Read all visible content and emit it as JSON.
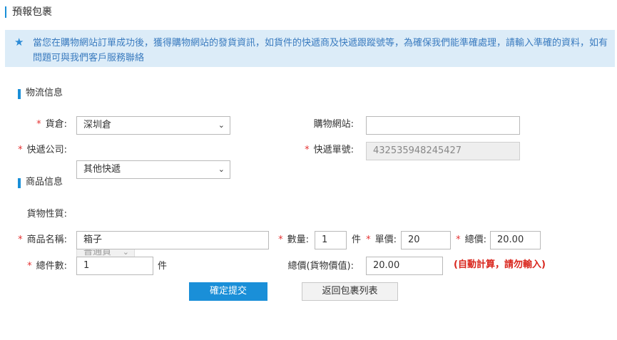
{
  "page": {
    "title": "預報包裹"
  },
  "notice": {
    "icon": "star-icon",
    "text": "當您在購物網站訂單成功後，獲得購物網站的發貨資訊，如貨件的快遞商及快遞跟蹤號等，為確保我們能準確處理，請輸入準確的資料，如有問題可與我們客戶服務聯絡"
  },
  "logistics": {
    "section_title": "物流信息",
    "warehouse": {
      "label": "貨倉:",
      "value": "深圳倉"
    },
    "shop_site": {
      "label": "購物網站:",
      "value": ""
    },
    "courier": {
      "label": "快遞公司:",
      "value": "其他快遞"
    },
    "tracking_no": {
      "label": "快遞單號:",
      "value": "432535948245427"
    }
  },
  "goods": {
    "section_title": "商品信息",
    "nature": {
      "label": "貨物性質:",
      "value": "普通貨"
    },
    "name": {
      "label": "商品名稱:",
      "value": "箱子"
    },
    "quantity": {
      "label": "數量:",
      "value": "1",
      "unit": "件"
    },
    "unit_price": {
      "label": "單價:",
      "value": "20"
    },
    "total_price": {
      "label": "總價:",
      "value": "20.00"
    },
    "total_pieces": {
      "label": "總件數:",
      "value": "1",
      "unit": "件"
    },
    "goods_value": {
      "label": "總價(貨物價值):",
      "value": "20.00"
    },
    "auto_hint": "(自動計算，請勿輸入)"
  },
  "actions": {
    "submit_label": "確定提交",
    "back_label": "返回包裹列表"
  },
  "colors": {
    "accent": "#1a8fd8",
    "notice_bg": "#dcecf8",
    "required": "#e53333",
    "hint": "#d9251c"
  }
}
